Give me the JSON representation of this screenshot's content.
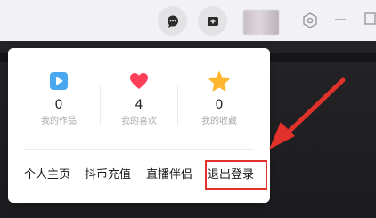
{
  "header": {
    "icons": [
      "message-bubble-icon",
      "add-video-icon",
      "settings-hexagon-icon",
      "minimize-icon",
      "maximize-icon"
    ]
  },
  "menu": {
    "stats": [
      {
        "icon": "play-icon",
        "value": "0",
        "label": "我的作品"
      },
      {
        "icon": "heart-icon",
        "value": "4",
        "label": "我的喜欢"
      },
      {
        "icon": "star-icon",
        "value": "0",
        "label": "我的收藏"
      }
    ],
    "links": [
      {
        "label": "个人主页"
      },
      {
        "label": "抖币充值"
      },
      {
        "label": "直播伴侣"
      },
      {
        "label": "退出登录"
      }
    ]
  },
  "colors": {
    "highlight": "#e0312a",
    "play": "#4aa8f0",
    "heart": "#ff3e5a",
    "star": "#ffb731"
  }
}
